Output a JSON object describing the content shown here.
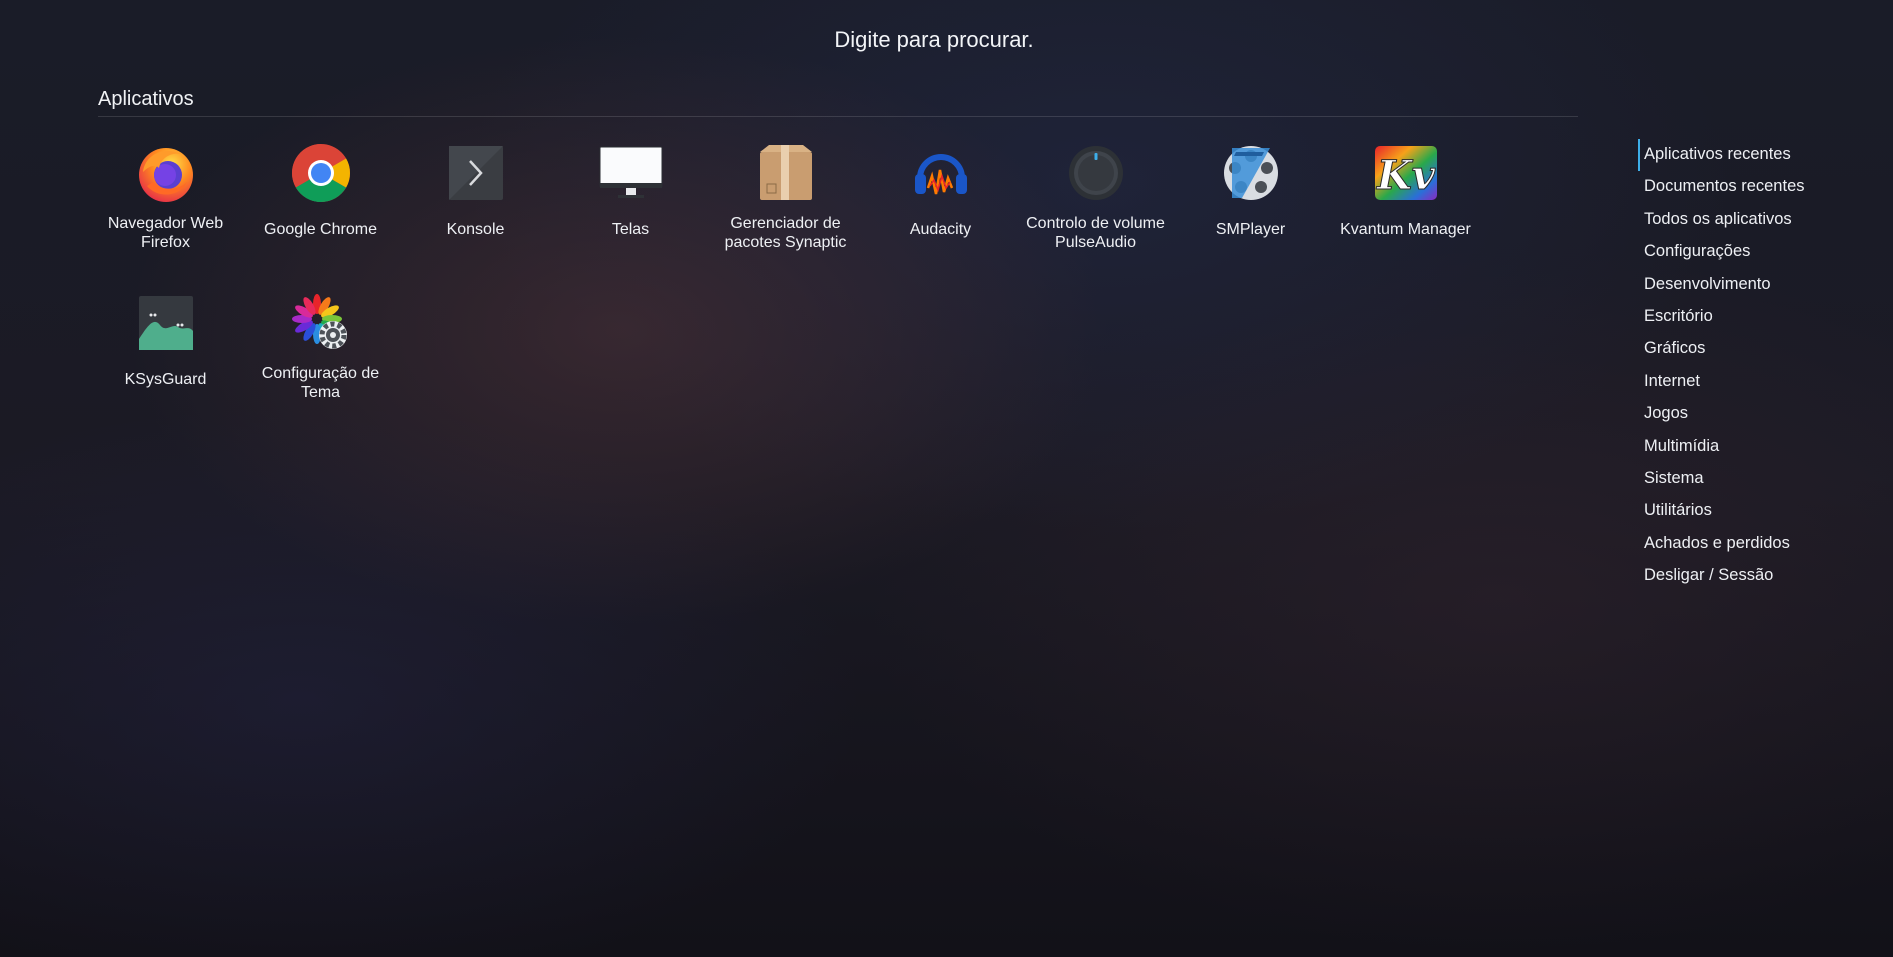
{
  "search": {
    "hint": "Digite para procurar."
  },
  "section": {
    "title": "Aplicativos"
  },
  "apps": [
    {
      "label": "Navegador Web Firefox",
      "icon": "firefox-icon"
    },
    {
      "label": "Google Chrome",
      "icon": "chrome-icon"
    },
    {
      "label": "Konsole",
      "icon": "konsole-icon"
    },
    {
      "label": "Telas",
      "icon": "monitor-icon"
    },
    {
      "label": "Gerenciador de pacotes Synaptic",
      "icon": "package-box-icon"
    },
    {
      "label": "Audacity",
      "icon": "audacity-icon"
    },
    {
      "label": "Controlo de volume PulseAudio",
      "icon": "volume-knob-icon"
    },
    {
      "label": "SMPlayer",
      "icon": "smplayer-icon"
    },
    {
      "label": "Kvantum Manager",
      "icon": "kvantum-icon"
    },
    {
      "label": "KSysGuard",
      "icon": "ksysguard-icon"
    },
    {
      "label": "Configuração de Tema",
      "icon": "theme-config-icon"
    }
  ],
  "categories": [
    "Aplicativos recentes",
    "Documentos recentes",
    "Todos os aplicativos",
    "Configurações",
    "Desenvolvimento",
    "Escritório",
    "Gráficos",
    "Internet",
    "Jogos",
    "Multimídia",
    "Sistema",
    "Utilitários",
    "Achados e perdidos",
    "Desligar / Sessão"
  ],
  "active_category_index": 0,
  "colors": {
    "accent": "#3daee9",
    "text": "#eef0f4"
  }
}
